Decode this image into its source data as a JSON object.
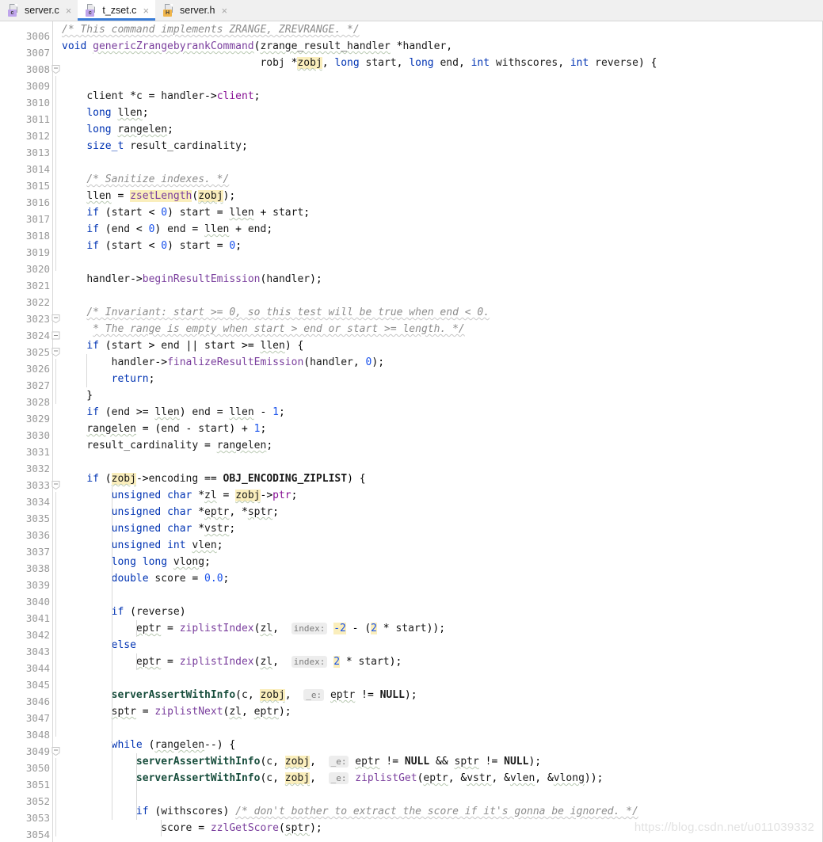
{
  "tabs": [
    {
      "label": "server.c",
      "icon": "c-file-icon",
      "badge": "c",
      "active": false,
      "close": "×"
    },
    {
      "label": "t_zset.c",
      "icon": "c-file-icon",
      "badge": "c",
      "active": true,
      "close": "×"
    },
    {
      "label": "server.h",
      "icon": "h-file-icon",
      "badge": "H",
      "active": false,
      "close": "×"
    }
  ],
  "editor": {
    "language": "C",
    "first_line_number": 3006,
    "watermark": "https://blog.csdn.net/u011039332",
    "colors": {
      "keyword": "#0033B3",
      "number": "#1750EB",
      "comment": "#8C8C8C",
      "function": "#7A3E9D",
      "field": "#871094",
      "macro": "#174D3C",
      "highlight": "#FAEEBC",
      "inlay_hint_bg": "#EDEDED",
      "accent": "#3A7DD8",
      "tabbar_bg": "#F0F0F0",
      "editor_bg": "#FFFFFF"
    },
    "line_numbers": [
      "3006",
      "3007",
      "3008",
      "3009",
      "3010",
      "3011",
      "3012",
      "3013",
      "3014",
      "3015",
      "3016",
      "3017",
      "3018",
      "3019",
      "3020",
      "3021",
      "3022",
      "3023",
      "3024",
      "3025",
      "3026",
      "3027",
      "3028",
      "3029",
      "3030",
      "3031",
      "3032",
      "3033",
      "3034",
      "3035",
      "3036",
      "3037",
      "3038",
      "3039",
      "3040",
      "3041",
      "3042",
      "3043",
      "3044",
      "3045",
      "3046",
      "3047",
      "3048",
      "3049",
      "3050",
      "3051",
      "3052",
      "3053",
      "3054"
    ],
    "inlay_hints": [
      "index:",
      "index:",
      "_e:",
      "_e:",
      "_e:"
    ],
    "highlighted_tokens": [
      "zsetLength",
      "zobj",
      "-2",
      "2"
    ],
    "lines": [
      "/* This command implements ZRANGE, ZREVRANGE. */",
      "void genericZrangebyrankCommand(zrange_result_handler *handler,",
      "                                robj *zobj, long start, long end, int withscores, int reverse) {",
      "",
      "    client *c = handler->client;",
      "    long llen;",
      "    long rangelen;",
      "    size_t result_cardinality;",
      "",
      "    /* Sanitize indexes. */",
      "    llen = zsetLength(zobj);",
      "    if (start < 0) start = llen + start;",
      "    if (end < 0) end = llen + end;",
      "    if (start < 0) start = 0;",
      "",
      "    handler->beginResultEmission(handler);",
      "",
      "    /* Invariant: start >= 0, so this test will be true when end < 0.",
      "     * The range is empty when start > end or start >= length. */",
      "    if (start > end || start >= llen) {",
      "        handler->finalizeResultEmission(handler, 0);",
      "        return;",
      "    }",
      "    if (end >= llen) end = llen - 1;",
      "    rangelen = (end - start) + 1;",
      "    result_cardinality = rangelen;",
      "",
      "    if (zobj->encoding == OBJ_ENCODING_ZIPLIST) {",
      "        unsigned char *zl = zobj->ptr;",
      "        unsigned char *eptr, *sptr;",
      "        unsigned char *vstr;",
      "        unsigned int vlen;",
      "        long long vlong;",
      "        double score = 0.0;",
      "",
      "        if (reverse)",
      "            eptr = ziplistIndex(zl,  index: -2 - (2 * start));",
      "        else",
      "            eptr = ziplistIndex(zl,  index: 2 * start);",
      "",
      "        serverAssertWithInfo(c, zobj,  _e: eptr != NULL);",
      "        sptr = ziplistNext(zl, eptr);",
      "",
      "        while (rangelen--) {",
      "            serverAssertWithInfo(c, zobj,  _e: eptr != NULL && sptr != NULL);",
      "            serverAssertWithInfo(c, zobj,  _e: ziplistGet(eptr, &vstr, &vlen, &vlong));",
      "",
      "            if (withscores) /* don't bother to extract the score if it's gonna be ignored. */",
      "                score = zzlGetScore(sptr);"
    ]
  }
}
